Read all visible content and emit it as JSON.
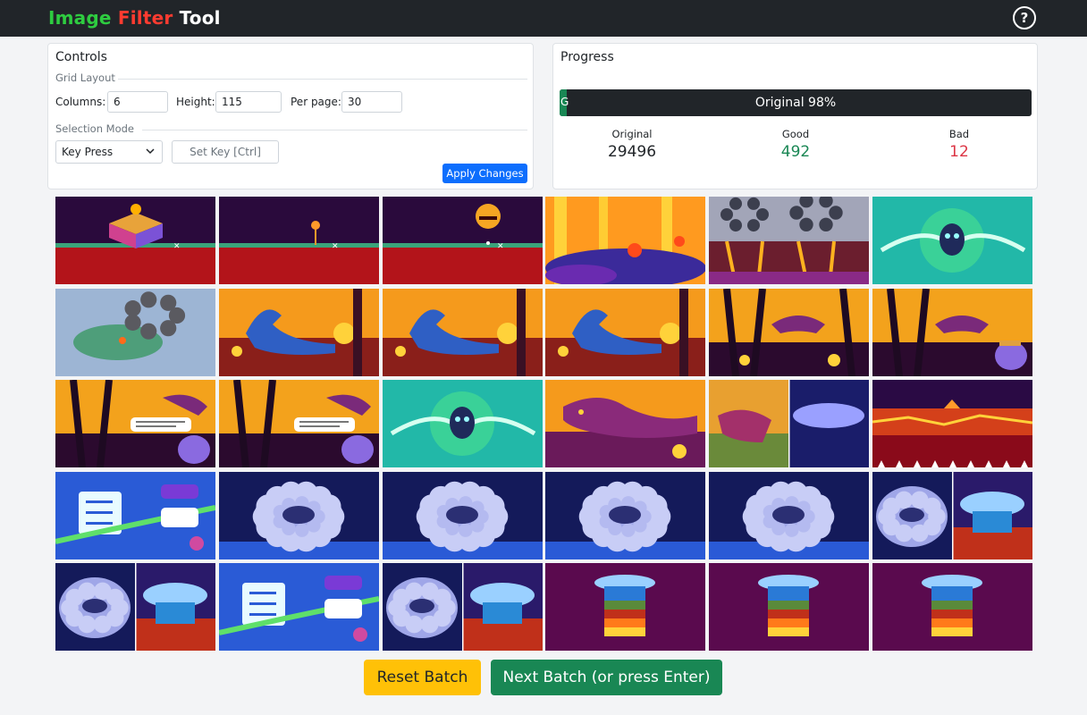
{
  "app": {
    "title_part1": "Image",
    "title_part2": "Filter",
    "title_part3": "Tool",
    "help_label": "?"
  },
  "controls": {
    "title": "Controls",
    "grid_layout_label": "Grid Layout",
    "columns_label": "Columns:",
    "columns_value": "6",
    "height_label": "Height:",
    "height_value": "115",
    "per_page_label": "Per page:",
    "per_page_value": "30",
    "selection_mode_label": "Selection Mode",
    "selection_mode_value": "Key Press",
    "set_key_label": "Set Key [Ctrl]",
    "apply_label": "Apply Changes"
  },
  "progress": {
    "title": "Progress",
    "bar_text": "Original 98%",
    "good_fill_label": "G",
    "good_fraction": 0.016,
    "stats": [
      {
        "label": "Original",
        "value": "29496",
        "color": "#212529"
      },
      {
        "label": "Good",
        "value": "492",
        "color": "#198754"
      },
      {
        "label": "Bad",
        "value": "12",
        "color": "#dc3545"
      }
    ]
  },
  "images": [
    {
      "kind": "terrain-cube"
    },
    {
      "kind": "terrain-line"
    },
    {
      "kind": "sun-face"
    },
    {
      "kind": "lava"
    },
    {
      "kind": "smoke-fire"
    },
    {
      "kind": "alien-blob"
    },
    {
      "kind": "smoke-map"
    },
    {
      "kind": "dino-fire"
    },
    {
      "kind": "dino-fire"
    },
    {
      "kind": "dino-fire"
    },
    {
      "kind": "fire-forest"
    },
    {
      "kind": "fire-bird"
    },
    {
      "kind": "fire-speech"
    },
    {
      "kind": "fire-speech"
    },
    {
      "kind": "alien-blob"
    },
    {
      "kind": "dino-purple"
    },
    {
      "kind": "split-dino-ice"
    },
    {
      "kind": "lava-crack"
    },
    {
      "kind": "notes-blue"
    },
    {
      "kind": "cloud-ring"
    },
    {
      "kind": "cloud-ring"
    },
    {
      "kind": "cloud-ring"
    },
    {
      "kind": "cloud-ring"
    },
    {
      "kind": "split-cloud-core"
    },
    {
      "kind": "split-cloud-core"
    },
    {
      "kind": "notes-blue"
    },
    {
      "kind": "split-cloud-core"
    },
    {
      "kind": "core-layers"
    },
    {
      "kind": "core-layers"
    },
    {
      "kind": "core-layers"
    }
  ],
  "buttons": {
    "reset_label": "Reset Batch",
    "next_label": "Next Batch (or press Enter)"
  }
}
